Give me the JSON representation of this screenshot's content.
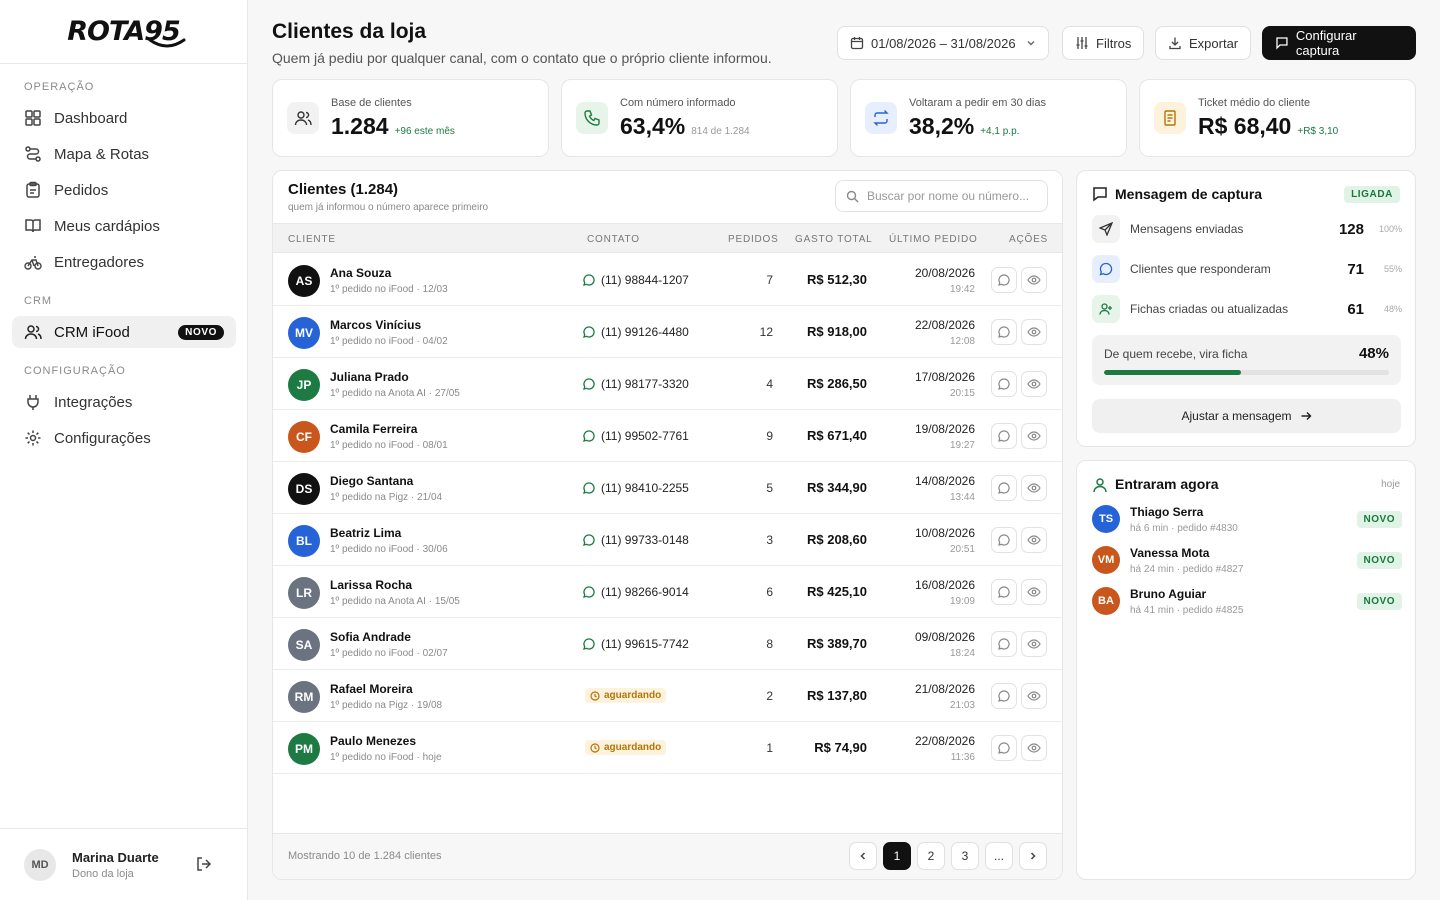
{
  "brand": {
    "logo": "ROTA95"
  },
  "sidebar": {
    "sections": {
      "operacao": "OPERAÇÃO",
      "crm": "CRM",
      "config": "CONFIGURAÇÃO"
    },
    "items": [
      {
        "label": "Dashboard",
        "icon": "dashboard-icon"
      },
      {
        "label": "Mapa & Rotas",
        "icon": "route-icon"
      },
      {
        "label": "Pedidos",
        "icon": "clipboard-icon"
      },
      {
        "label": "Meus cardápios",
        "icon": "book-icon"
      },
      {
        "label": "Entregadores",
        "icon": "bike-icon"
      },
      {
        "label": "CRM iFood",
        "icon": "users-icon",
        "badge": "NOVO",
        "active": true
      },
      {
        "label": "Integrações",
        "icon": "plug-icon"
      },
      {
        "label": "Configurações",
        "icon": "gear-icon"
      }
    ],
    "user": {
      "initials": "MD",
      "name": "Marina Duarte",
      "role": "Dono da loja"
    }
  },
  "header": {
    "title": "Clientes da loja",
    "subtitle": "Quem já pediu por qualquer canal, com o contato que o próprio cliente informou.",
    "date_range": "01/08/2026 – 31/08/2026",
    "filters_label": "Filtros",
    "export_label": "Exportar",
    "config_label": "Configurar captura"
  },
  "kpis": [
    {
      "label": "Base de clientes",
      "value": "1.284",
      "delta": "+96 este mês",
      "delta_color": "#1d7a43",
      "icon": "users-icon"
    },
    {
      "label": "Com número informado",
      "value": "63,4%",
      "delta": "814 de 1.284",
      "delta_color": "#999999",
      "icon": "phone-icon"
    },
    {
      "label": "Voltaram a pedir em 30 dias",
      "value": "38,2%",
      "delta": "+4,1 p.p.",
      "delta_color": "#1d7a43",
      "icon": "repeat-icon"
    },
    {
      "label": "Ticket médio do cliente",
      "value": "R$ 68,40",
      "delta": "+R$ 3,10",
      "delta_color": "#1d7a43",
      "icon": "receipt-icon"
    }
  ],
  "table": {
    "title": "Clientes (1.284)",
    "subtitle": "quem já informou o número aparece primeiro",
    "search_placeholder": "Buscar por nome ou número...",
    "columns": {
      "cliente": "CLIENTE",
      "contato": "CONTATO",
      "pedidos": "PEDIDOS",
      "gasto": "GASTO TOTAL",
      "ultimo": "ÚLTIMO PEDIDO",
      "acoes": "AÇÕES"
    },
    "rows": [
      {
        "initials": "AS",
        "color": "#111111",
        "name": "Ana Souza",
        "origin": "1º pedido no iFood · 12/03",
        "contact": "(11) 98844-1207",
        "orders": "7",
        "spent": "R$ 512,30",
        "date": "20/08/2026",
        "time": "19:42"
      },
      {
        "initials": "MV",
        "color": "#2563d6",
        "name": "Marcos Vinícius",
        "origin": "1º pedido no iFood · 04/02",
        "contact": "(11) 99126-4480",
        "orders": "12",
        "spent": "R$ 918,00",
        "date": "22/08/2026",
        "time": "12:08"
      },
      {
        "initials": "JP",
        "color": "#1d7a43",
        "name": "Juliana Prado",
        "origin": "1º pedido na Anota AI · 27/05",
        "contact": "(11) 98177-3320",
        "orders": "4",
        "spent": "R$ 286,50",
        "date": "17/08/2026",
        "time": "20:15"
      },
      {
        "initials": "CF",
        "color": "#c9561c",
        "name": "Camila Ferreira",
        "origin": "1º pedido no iFood · 08/01",
        "contact": "(11) 99502-7761",
        "orders": "9",
        "spent": "R$ 671,40",
        "date": "19/08/2026",
        "time": "19:27"
      },
      {
        "initials": "DS",
        "color": "#111111",
        "name": "Diego Santana",
        "origin": "1º pedido na Pigz · 21/04",
        "contact": "(11) 98410-2255",
        "orders": "5",
        "spent": "R$ 344,90",
        "date": "14/08/2026",
        "time": "13:44"
      },
      {
        "initials": "BL",
        "color": "#2563d6",
        "name": "Beatriz Lima",
        "origin": "1º pedido no iFood · 30/06",
        "contact": "(11) 99733-0148",
        "orders": "3",
        "spent": "R$ 208,60",
        "date": "10/08/2026",
        "time": "20:51"
      },
      {
        "initials": "LR",
        "color": "#6b7280",
        "name": "Larissa Rocha",
        "origin": "1º pedido na Anota AI · 15/05",
        "contact": "(11) 98266-9014",
        "orders": "6",
        "spent": "R$ 425,10",
        "date": "16/08/2026",
        "time": "19:09"
      },
      {
        "initials": "SA",
        "color": "#6b7280",
        "name": "Sofia Andrade",
        "origin": "1º pedido no iFood · 02/07",
        "contact": "(11) 99615-7742",
        "orders": "8",
        "spent": "R$ 389,70",
        "date": "09/08/2026",
        "time": "18:24"
      },
      {
        "initials": "RM",
        "color": "#6b7280",
        "name": "Rafael Moreira",
        "origin": "1º pedido na Pigz · 19/08",
        "contact": "",
        "status": "aguardando",
        "orders": "2",
        "spent": "R$ 137,80",
        "date": "21/08/2026",
        "time": "21:03"
      },
      {
        "initials": "PM",
        "color": "#1d7a43",
        "name": "Paulo Menezes",
        "origin": "1º pedido no iFood · hoje",
        "contact": "",
        "status": "aguardando",
        "orders": "1",
        "spent": "R$ 74,90",
        "date": "22/08/2026",
        "time": "11:36"
      }
    ],
    "footer": {
      "showing": "Mostrando 10 de 1.284 clientes",
      "pages": [
        "1",
        "2",
        "3",
        "..."
      ],
      "current_page": "1"
    }
  },
  "capture": {
    "title": "Mensagem de captura",
    "status": "LIGADA",
    "metrics": [
      {
        "label": "Mensagens enviadas",
        "value": "128",
        "pct": "100%",
        "icon": "send-icon"
      },
      {
        "label": "Clientes que responderam",
        "value": "71",
        "pct": "55%",
        "icon": "chat-icon"
      },
      {
        "label": "Fichas criadas ou atualizadas",
        "value": "61",
        "pct": "48%",
        "icon": "user-plus-icon"
      }
    ],
    "ficha_label": "De quem recebe, vira ficha",
    "ficha_value": "48%",
    "ficha_fraction": 0.48,
    "adjust_label": "Ajustar a mensagem"
  },
  "recent": {
    "title": "Entraram agora",
    "when": "hoje",
    "items": [
      {
        "initials": "TS",
        "color": "#2563d6",
        "name": "Thiago Serra",
        "meta": "há 6 min · pedido #4830",
        "badge": "NOVO"
      },
      {
        "initials": "VM",
        "color": "#c9561c",
        "name": "Vanessa Mota",
        "meta": "há 24 min · pedido #4827",
        "badge": "NOVO"
      },
      {
        "initials": "BA",
        "color": "#c9561c",
        "name": "Bruno Aguiar",
        "meta": "há 41 min · pedido #4825",
        "badge": "NOVO"
      }
    ]
  }
}
